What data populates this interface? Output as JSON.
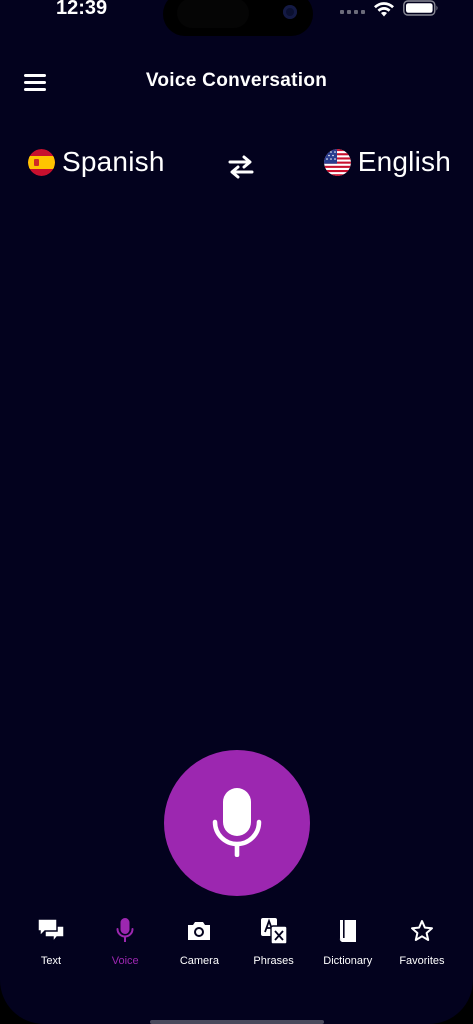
{
  "status_bar": {
    "time": "12:39"
  },
  "header": {
    "title": "Voice Conversation"
  },
  "languages": {
    "source": {
      "label": "Spanish",
      "flag": "spain-flag-icon"
    },
    "target": {
      "label": "English",
      "flag": "usa-flag-icon"
    }
  },
  "nav": {
    "items": [
      {
        "label": "Text",
        "icon": "chat-bubbles-icon"
      },
      {
        "label": "Voice",
        "icon": "mic-icon",
        "active": true
      },
      {
        "label": "Camera",
        "icon": "camera-icon"
      },
      {
        "label": "Phrases",
        "icon": "translate-icon"
      },
      {
        "label": "Dictionary",
        "icon": "book-icon"
      },
      {
        "label": "Favorites",
        "icon": "star-icon"
      }
    ]
  },
  "colors": {
    "background": "#03021e",
    "accent": "#9c27b0",
    "text": "#ffffff"
  }
}
